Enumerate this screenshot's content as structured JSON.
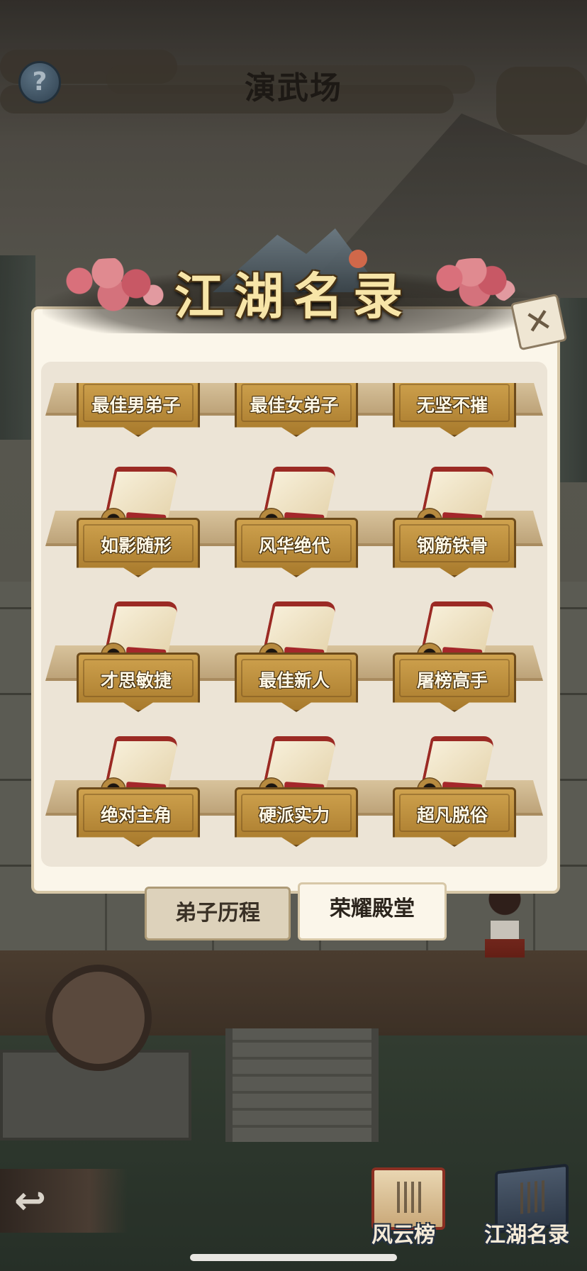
{
  "header": {
    "title": "演武场",
    "help_icon": "?"
  },
  "modal": {
    "title": "江湖名录",
    "close_icon": "✕",
    "awards": [
      {
        "label": "最佳男弟子"
      },
      {
        "label": "最佳女弟子"
      },
      {
        "label": "无坚不摧"
      },
      {
        "label": "如影随形"
      },
      {
        "label": "风华绝代"
      },
      {
        "label": "钢筋铁骨"
      },
      {
        "label": "才思敏捷"
      },
      {
        "label": "最佳新人"
      },
      {
        "label": "屠榜高手"
      },
      {
        "label": "绝对主角"
      },
      {
        "label": "硬派实力"
      },
      {
        "label": "超凡脱俗"
      }
    ],
    "tabs": [
      {
        "label": "弟子历程",
        "active": false
      },
      {
        "label": "荣耀殿堂",
        "active": true
      }
    ]
  },
  "bottom": {
    "back_icon": "↩",
    "buttons": [
      {
        "label": "风云榜",
        "icon": "scroll-book-icon"
      },
      {
        "label": "江湖名录",
        "icon": "blue-book-icon"
      }
    ]
  },
  "colors": {
    "accent_gold": "#cfa24e",
    "scroll_red": "#9b2a24",
    "panel": "#fbf6ea"
  }
}
